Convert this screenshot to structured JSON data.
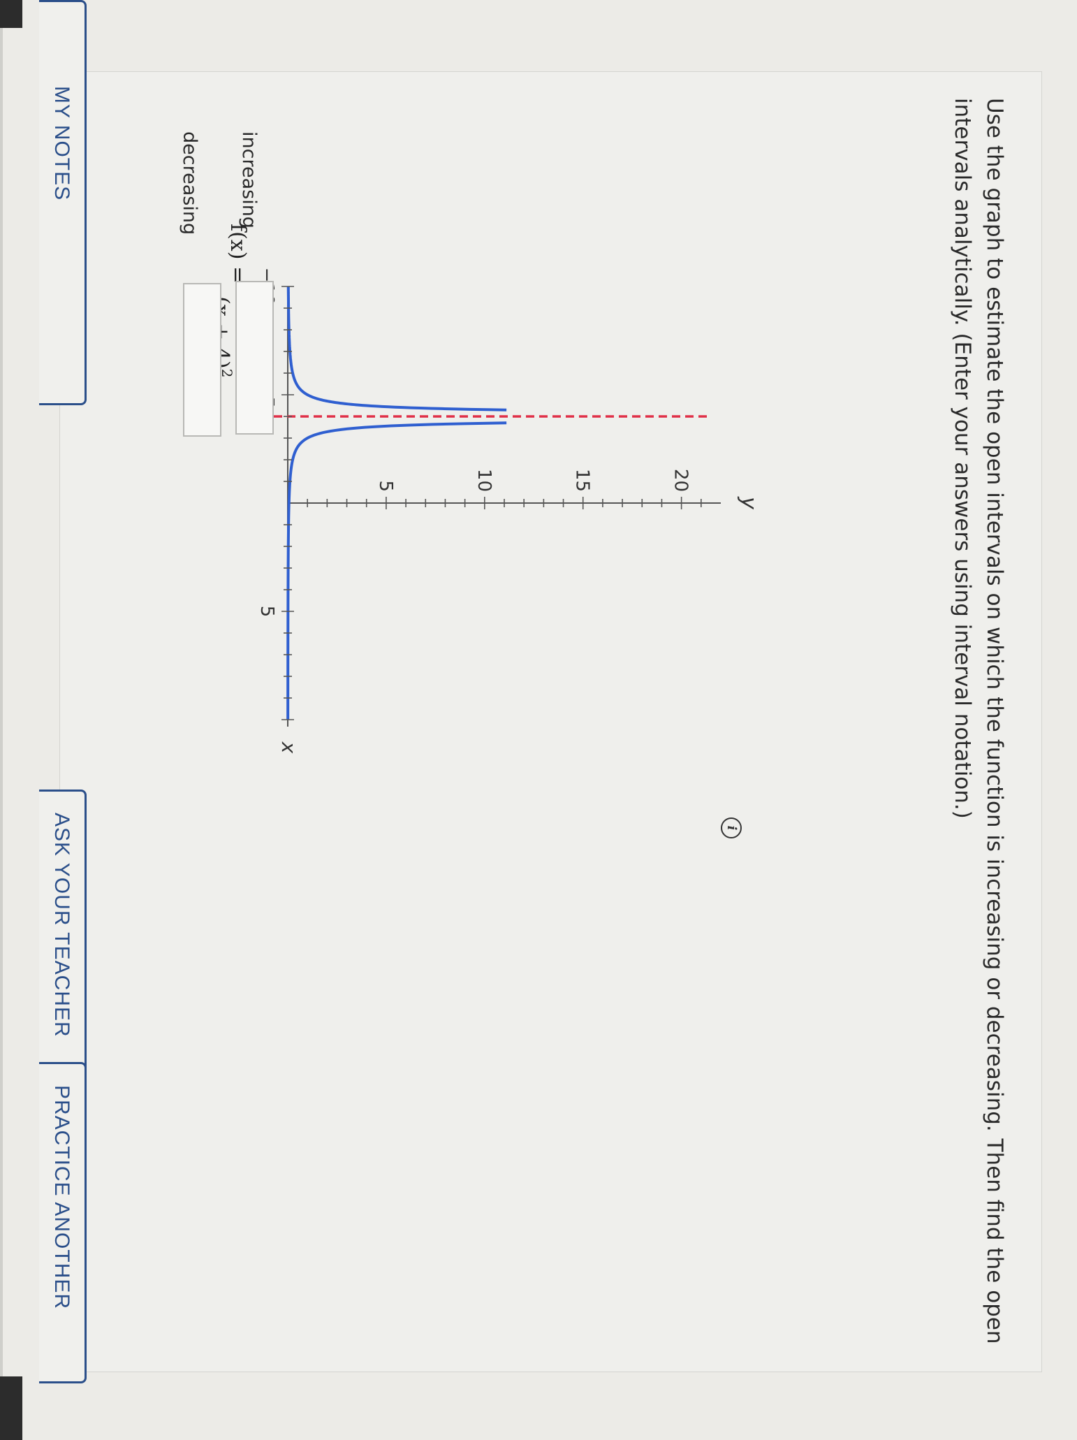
{
  "problem": {
    "instruction": "Use the graph to estimate the open intervals on which the function is increasing or decreasing. Then find the open intervals analytically. (Enter your answers using interval notation.)",
    "formula": {
      "lhs": "f(x) =",
      "numerator": "1",
      "denominator": "(x + 4)",
      "exponent": "2"
    }
  },
  "chart_data": {
    "type": "line",
    "function": "1/(x+4)^2",
    "x_axis_label": "x",
    "y_axis_label": "y",
    "xlim": [
      -10,
      10
    ],
    "ylim": [
      0,
      22
    ],
    "x_tick_labels": [
      "−10",
      "−5",
      "5"
    ],
    "y_tick_labels": [
      "5",
      "10",
      "15",
      "20"
    ],
    "vertical_asymptote": -4,
    "grid": false,
    "series": [
      {
        "color": "#2f5fd0",
        "branch": "left",
        "x": [
          -10,
          -9,
          -8,
          -7,
          -6,
          -5,
          -4.5,
          -4.3
        ],
        "y": [
          0.03,
          0.04,
          0.06,
          0.11,
          0.25,
          1,
          4,
          11.1
        ]
      },
      {
        "color": "#2f5fd0",
        "branch": "right",
        "x": [
          -3.7,
          -3.5,
          -3,
          -2,
          -1,
          0,
          2,
          4,
          6,
          8,
          10
        ],
        "y": [
          11.1,
          4,
          1,
          0.25,
          0.11,
          0.06,
          0.03,
          0.02,
          0.01,
          0.007,
          0.005
        ]
      }
    ],
    "asymptote_color": "#e03048"
  },
  "answers": {
    "increasing_label": "increasing",
    "increasing_value": "",
    "decreasing_label": "decreasing",
    "decreasing_value": ""
  },
  "info_icon": {
    "name": "info-icon",
    "glyph": "i"
  },
  "buttons": {
    "my_notes": "MY NOTES",
    "ask_teacher": "ASK YOUR TEACHER",
    "practice_another": "PRACTICE ANOTHER"
  }
}
